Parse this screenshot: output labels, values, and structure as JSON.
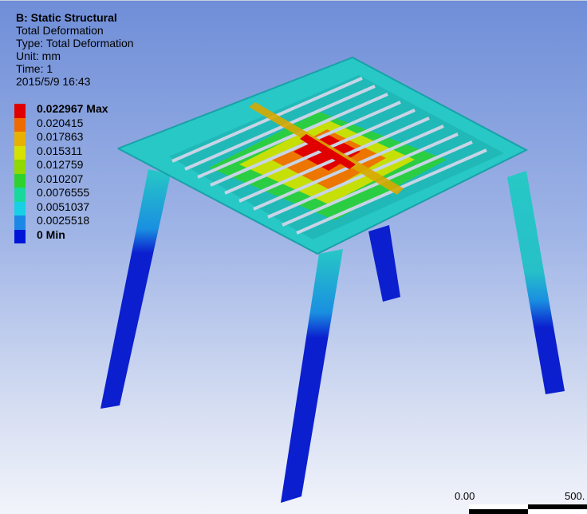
{
  "header": {
    "title": "B: Static Structural",
    "line1": "Total Deformation",
    "line2": "Type: Total Deformation",
    "line3": "Unit: mm",
    "line4": "Time: 1",
    "line5": "2015/5/9 16:43"
  },
  "legend": [
    {
      "label": "0.022967 Max",
      "color": "#e00000",
      "bold": true
    },
    {
      "label": "0.020415",
      "color": "#ef6a00"
    },
    {
      "label": "0.017863",
      "color": "#e8b000"
    },
    {
      "label": "0.015311",
      "color": "#d7e100"
    },
    {
      "label": "0.012759",
      "color": "#8fd800"
    },
    {
      "label": "0.010207",
      "color": "#2ed12e"
    },
    {
      "label": "0.0076555",
      "color": "#18d89c"
    },
    {
      "label": "0.0051037",
      "color": "#18d0e6"
    },
    {
      "label": "0.0025518",
      "color": "#1b88e6"
    },
    {
      "label": "0 Min",
      "color": "#0014d8",
      "bold": true
    }
  ],
  "scale": {
    "left": "0.00",
    "right": "500."
  },
  "colors": {
    "legs_low": "#0b1fcf",
    "legs_mid": "#1f7ee0",
    "legs_high": "#1ec8d4",
    "frame": "#27c8c6",
    "bars": "#c8d4e6"
  }
}
